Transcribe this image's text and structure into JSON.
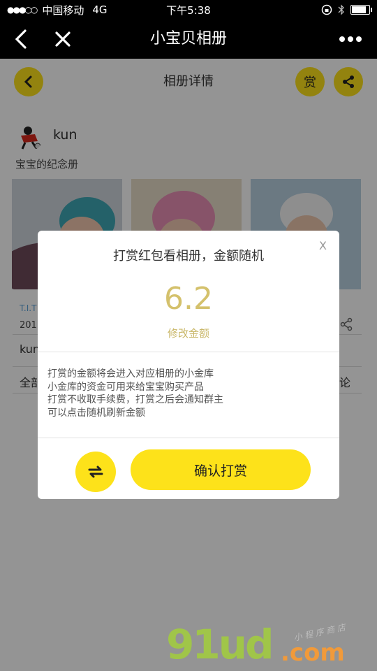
{
  "status_bar": {
    "signal": "●●●○○",
    "carrier": "中国移动",
    "network": "4G",
    "time": "下午5:38",
    "battery_level": 0.85
  },
  "nav": {
    "title": "小宝贝相册"
  },
  "page": {
    "title": "相册详情",
    "reward_label": "赏",
    "author": "kun",
    "album_desc": "宝宝的纪念册",
    "meta_1": "T.I.T",
    "meta_2": "201",
    "row_kun": "kun",
    "row_all": "全部",
    "row_comment": "论"
  },
  "modal": {
    "title": "打赏红包看相册，金额随机",
    "close": "X",
    "amount": "6.2",
    "modify": "修改金额",
    "notes": [
      "打赏的金额将会进入对应相册的小金库",
      "小金库的资金可用来给宝宝购买产品",
      "打赏不收取手续费，打赏之后会通知群主",
      "可以点击随机刷新金额"
    ],
    "confirm": "确认打赏"
  },
  "watermark": {
    "main": "91ud",
    "dot": ".com",
    "sub": "小 程 序 商 店"
  },
  "colors": {
    "accent": "#fde21a",
    "amount": "#d4c16c",
    "watermark_green": "#a3ce3c",
    "watermark_orange": "#f19a3a"
  }
}
